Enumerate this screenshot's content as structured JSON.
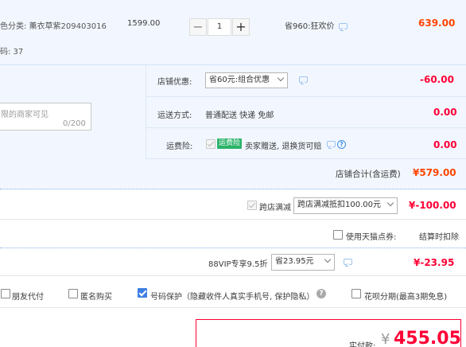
{
  "item": {
    "sku_text": "色分类: 薰衣草紫209403016",
    "sku_code_text": "码: 37",
    "unit_price": "1599.00",
    "qty_minus": "−",
    "qty_value": "1",
    "qty_plus": "+",
    "promo_text": "省960:狂欢价",
    "subtotal": "639.00"
  },
  "shop": {
    "discount_label": "店铺优惠:",
    "discount_select": "省60元:组合优惠",
    "discount_amount": "-60.00",
    "shipping_label": "运送方式:",
    "shipping_text": "普通配送 快递 免邮",
    "shipping_amount": "0.00",
    "insurance_label": "运费险:",
    "insurance_badge": "运费险",
    "insurance_text": "卖家赠送, 退换货可赔",
    "insurance_amount": "0.00",
    "message_placeholder": "限的商家可见",
    "message_counter": "0/200",
    "total_label": "店铺合计(含运费)",
    "total_amount": "¥579.00"
  },
  "cross_store": {
    "label": "跨店满减",
    "select": "跨店满减抵扣100.00元",
    "amount": "¥-100.00"
  },
  "tmall_points": {
    "label": "使用天猫点券:",
    "note": "结算时扣除"
  },
  "vip": {
    "label": "88VIP专享9.5折",
    "select": "省23.95元",
    "amount": "¥-23.95"
  },
  "options": {
    "friend_pay": "朋友代付",
    "anonymous": "匿名购买",
    "number_protect": "号码保护（隐藏收件人真实手机号, 保护隐私）",
    "installment": "花呗分期(最高3期免息)"
  },
  "payment": {
    "label": "实付款:",
    "currency": "¥",
    "amount": "455.05"
  },
  "icons": {
    "chat": "chat-bubble-icon",
    "question": "question-circle-icon",
    "help": "help-circle-icon",
    "check": "check-icon",
    "chevron": "chevron-down-icon"
  },
  "colors": {
    "accent_red": "#ff0036",
    "price_orange": "#ff4400",
    "link_blue": "#3e90e4",
    "panel_blue": "#f2f7ff"
  }
}
